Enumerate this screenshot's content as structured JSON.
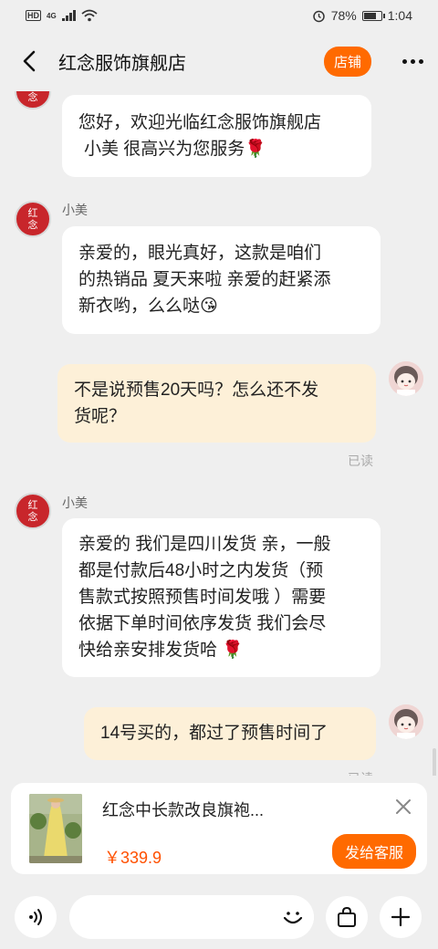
{
  "status_bar": {
    "hd_label": "HD",
    "network_label": "4G",
    "battery_percent": "78%",
    "battery_level": 0.78,
    "time": "1:04",
    "icons": [
      "signal-icon",
      "wifi-icon",
      "alarm-icon",
      "battery-icon"
    ]
  },
  "header": {
    "back_icon": "chevron-left-icon",
    "title": "红念服饰旗舰店",
    "shop_button": "店铺",
    "more_icon": "more-dots-icon"
  },
  "messages": [
    {
      "from": "shop",
      "name": "",
      "lines": [
        "您好，欢迎光临红念服饰旗舰店",
        "小美 很高兴为您服务🌹"
      ]
    },
    {
      "from": "shop",
      "name": "小美",
      "lines": [
        "亲爱的，眼光真好，这款是咱们",
        "的热销品 夏天来啦 亲爱的赶紧添",
        "新衣哟，么么哒😘"
      ]
    },
    {
      "from": "user",
      "lines": [
        "不是说预售20天吗？怎么还不发",
        "货呢？"
      ],
      "status": "已读"
    },
    {
      "from": "shop",
      "name": "小美",
      "lines": [
        "亲爱的 我们是四川发货 亲，一般",
        "都是付款后48小时之内发货（预",
        "售款式按照预售时间发哦 ）需要",
        "依据下单时间依序发货 我们会尽",
        "快给亲安排发货哈 🌹"
      ]
    },
    {
      "from": "user",
      "lines": [
        "14号买的，都过了预售时间了"
      ],
      "status": "已读"
    }
  ],
  "shop_avatar_text": [
    "红",
    "念"
  ],
  "product": {
    "title": "红念中长款改良旗袍...",
    "price": "￥339.9",
    "send_button": "发给客服",
    "close_icon": "close-icon"
  },
  "input_bar": {
    "voice_icon": "voice-icon",
    "placeholder": "",
    "emoji_icon": "emoji-icon",
    "bag_icon": "shopping-bag-icon",
    "plus_icon": "plus-icon"
  },
  "colors": {
    "accent": "#ff6a00",
    "price": "#ff5000",
    "my_bubble": "#fdf0d8",
    "shop_avatar": "#c8262b"
  }
}
